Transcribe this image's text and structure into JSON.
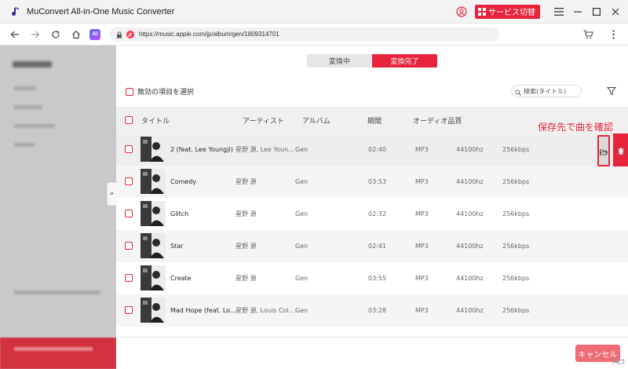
{
  "window": {
    "title": "MuConvert All-in-One Music Converter",
    "service_button": "サービス切替"
  },
  "browser": {
    "url": "https://music.apple.com/jp/album/gen/1809314701",
    "ai_badge": "AI"
  },
  "tabs": [
    {
      "label": "変換中",
      "active": false
    },
    {
      "label": "変換完了",
      "active": true
    }
  ],
  "toolbar": {
    "select_invalid_label": "無効の項目を選択",
    "search_placeholder": "検索(タイトル)"
  },
  "table": {
    "headers": {
      "title": "タイトル",
      "artist": "アーティスト",
      "album": "アルバム",
      "duration": "期間",
      "audio_quality": "オーディオ品質"
    },
    "rows": [
      {
        "title": "2 (feat. Lee Youngji)",
        "artist": "星野 源, Lee Youn...",
        "album": "Gen",
        "duration": "02:40",
        "format": "MP3",
        "samplerate": "44100hz",
        "bitrate": "256kbps"
      },
      {
        "title": "Comedy",
        "artist": "星野 源",
        "album": "Gen",
        "duration": "03:53",
        "format": "MP3",
        "samplerate": "44100hz",
        "bitrate": "256kbps"
      },
      {
        "title": "Glitch",
        "artist": "星野 源",
        "album": "Gen",
        "duration": "02:32",
        "format": "MP3",
        "samplerate": "44100hz",
        "bitrate": "256kbps"
      },
      {
        "title": "Star",
        "artist": "星野 源",
        "album": "Gen",
        "duration": "02:41",
        "format": "MP3",
        "samplerate": "44100hz",
        "bitrate": "256kbps"
      },
      {
        "title": "Create",
        "artist": "星野 源",
        "album": "Gen",
        "duration": "03:55",
        "format": "MP3",
        "samplerate": "44100hz",
        "bitrate": "256kbps"
      },
      {
        "title": "Mad Hope (feat. Lo...",
        "artist": "星野 源, Louis Col...",
        "album": "Gen",
        "duration": "03:28",
        "format": "MP3",
        "samplerate": "44100hz",
        "bitrate": "256kbps"
      }
    ]
  },
  "annotation": "保存先で曲を確認",
  "footer": {
    "cancel_button": "キャンセル"
  },
  "watermark": "Act",
  "colors": {
    "accent": "#e8243c",
    "cancel": "#ef6b76"
  }
}
